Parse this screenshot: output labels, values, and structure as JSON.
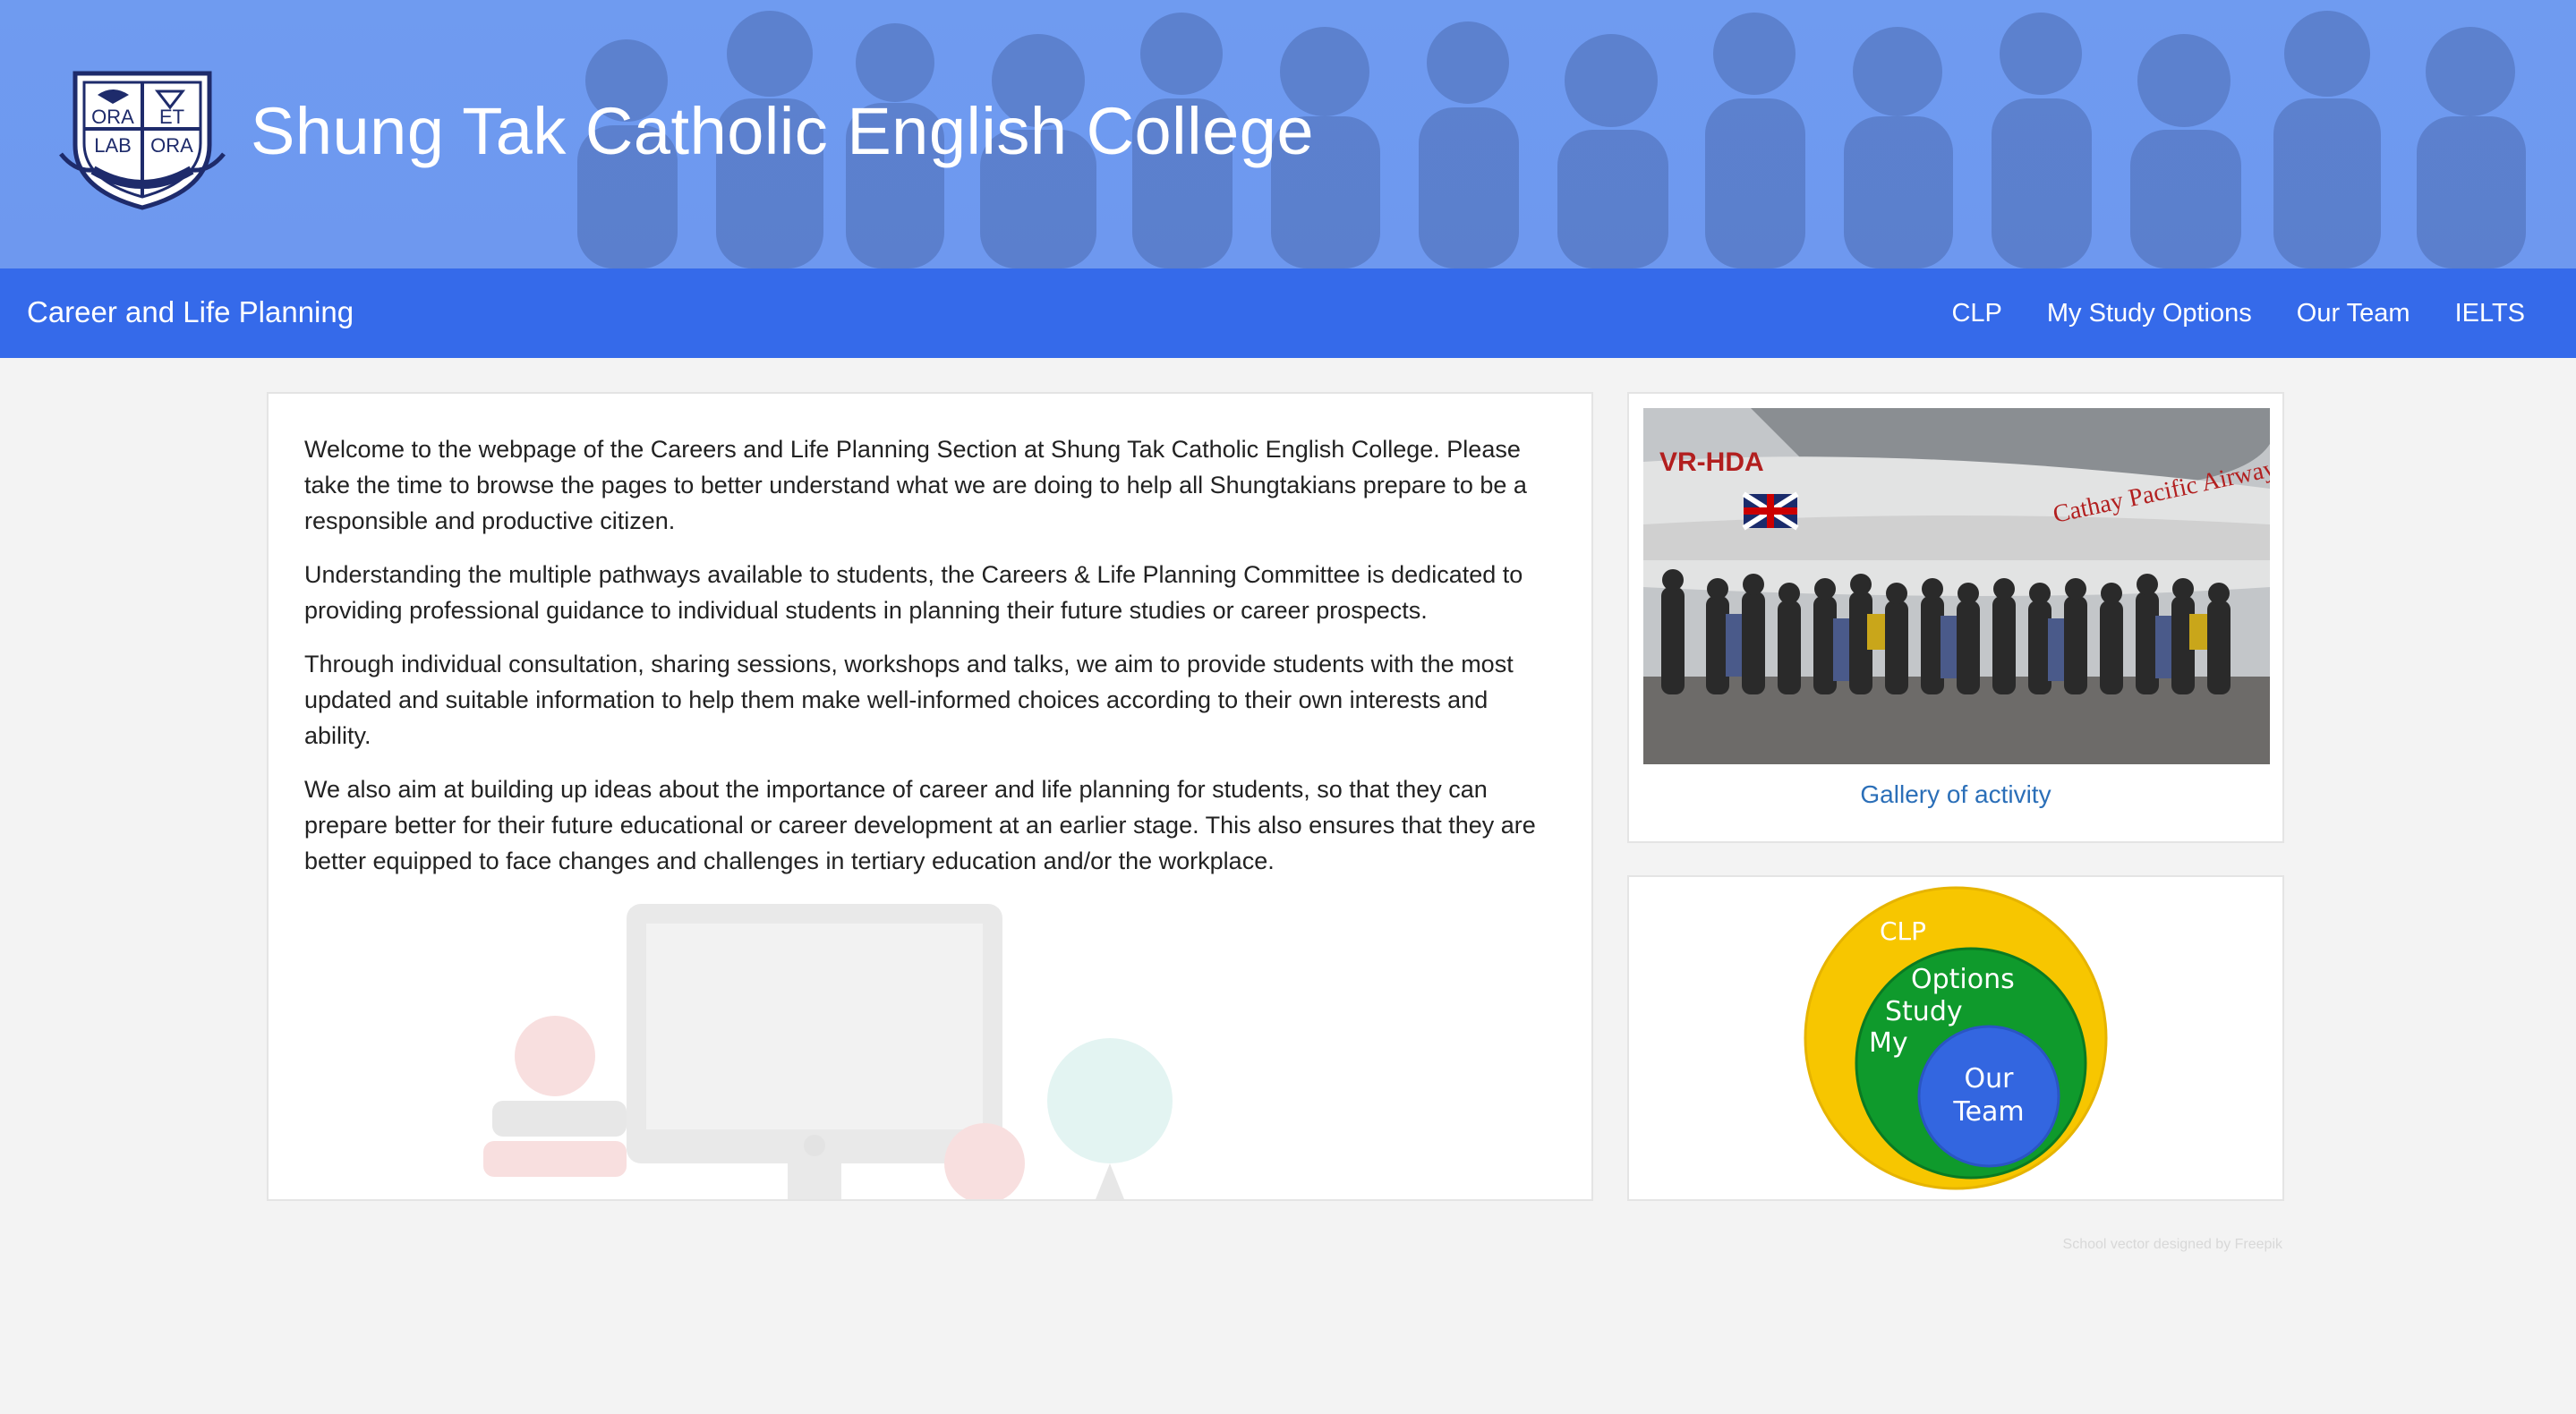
{
  "header": {
    "logo": {
      "motto_top_left": "ORA",
      "motto_top_right": "ET",
      "motto_bottom_left": "LAB",
      "motto_bottom_right": "ORA"
    },
    "title": "Shung Tak Catholic English College"
  },
  "navbar": {
    "brand": "Career and Life Planning",
    "links": [
      "CLP",
      "My Study Options",
      "Our Team",
      "IELTS"
    ]
  },
  "main": {
    "paragraphs": [
      "Welcome to the webpage of the Careers and Life Planning Section at Shung Tak Catholic English College. Please take the time to browse the pages to better understand what we are doing to help all Shungtakians prepare to be a responsible and productive citizen.",
      "Understanding the multiple pathways available to students, the Careers & Life Planning Committee is dedicated to providing professional guidance to individual students in planning their future studies or career prospects.",
      "Through individual consultation, sharing sessions, workshops and talks, we aim to provide students with the most updated and suitable information to help them make well-informed choices according to their own interests and ability.",
      "We also aim at building up ideas about the importance of career and life planning for students, so that they can prepare better for their future educational or career development at an earlier stage. This also ensures that they are better equipped to face changes and challenges in tertiary education and/or the workplace."
    ]
  },
  "gallery": {
    "photo_text_registration": "VR-HDA",
    "photo_text_airline": "Cathay Pacific Airways",
    "link_label": "Gallery of activity"
  },
  "circles": {
    "outer_label": "CLP",
    "middle_label_line1": "Options",
    "middle_label_line2": "Study",
    "middle_label_line3": "My",
    "inner_label_line1": "Our",
    "inner_label_line2": "Team",
    "colors": {
      "outer": "#f7c600",
      "middle": "#0f9a2c",
      "inner": "#3366e0"
    }
  },
  "footer": {
    "credit": "School vector designed by Freepik"
  },
  "colors": {
    "banner": "#6f9bf0",
    "navbar": "#356aea",
    "link": "#2b6fb8",
    "page_bg": "#f3f3f3"
  }
}
